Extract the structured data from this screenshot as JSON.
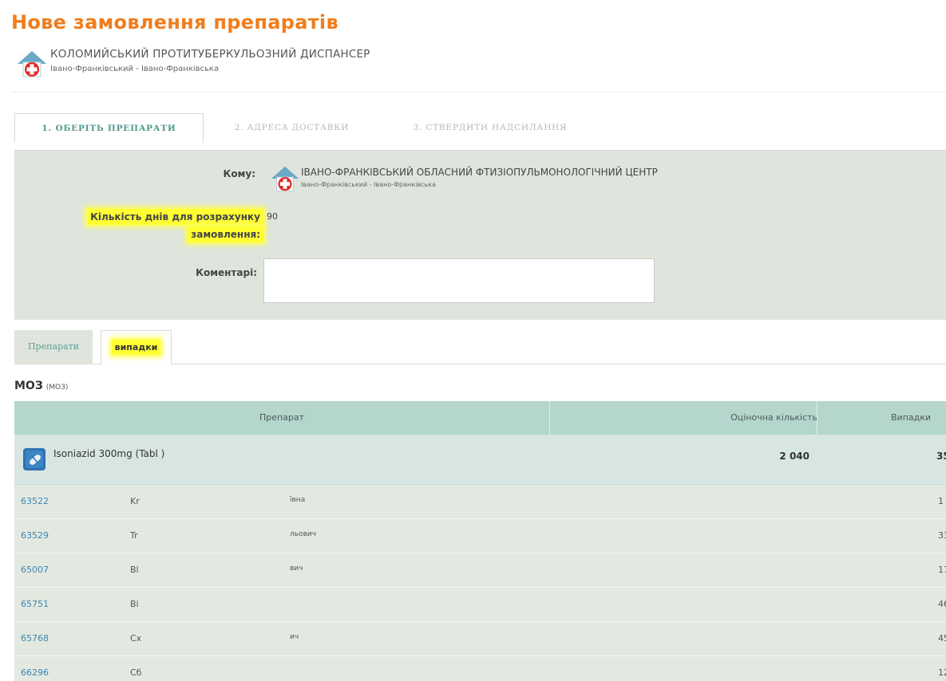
{
  "page": {
    "title": "Нове замовлення препаратів"
  },
  "org": {
    "name": "КОЛОМИЙСЬКИЙ ПРОТИТУБЕРКУЛЬОЗНИЙ ДИСПАНСЕР",
    "region": "Івано-Франківський - Івано-Франківська"
  },
  "wizard": {
    "steps": [
      {
        "label": "1. ОБЕРІТЬ ПРЕПАРАТИ",
        "active": true
      },
      {
        "label": "2. АДРЕСА ДОСТАВКИ",
        "active": false
      },
      {
        "label": "3. СТВЕРДИТИ НАДСИЛАННЯ",
        "active": false
      }
    ]
  },
  "form": {
    "komu_label": "Кому:",
    "recipient_name": "ІВАНО-ФРАНКІВСЬКИЙ ОБЛАСНИЙ ФТИЗІОПУЛЬМОНОЛОГІЧНИЙ ЦЕНТР",
    "recipient_region": "Івано-Франківський - Івано-Франківська",
    "days_label_line1": "Кількість днів для розрахунку",
    "days_label_line2": "замовлення:",
    "days_value": "90",
    "comment_label": "Коментарі:",
    "comment_value": ""
  },
  "tabs": [
    {
      "label": "Препарати",
      "active": false
    },
    {
      "label": "випадки",
      "active": true
    }
  ],
  "section": {
    "title": "МОЗ",
    "subtitle": "(МОЗ)"
  },
  "table": {
    "columns": [
      "Препарат",
      "Оціночна кількість",
      "Випадки"
    ],
    "drug": {
      "name": "Isoniazid 300mg (Tabl )",
      "quantity": "2 040",
      "cases": "35"
    },
    "rows": [
      {
        "id": "63522",
        "a": "Kr",
        "b": "ївна",
        "n": "1"
      },
      {
        "id": "63529",
        "a": "Tr",
        "b": "льович",
        "n": "33"
      },
      {
        "id": "65007",
        "a": "Bl",
        "b": "вич",
        "n": "17"
      },
      {
        "id": "65751",
        "a": "Bi",
        "b": "",
        "n": "46"
      },
      {
        "id": "65768",
        "a": "Cx",
        "b": "ич",
        "n": "45"
      },
      {
        "id": "66296",
        "a": "Сб",
        "b": "",
        "n": "12"
      }
    ]
  },
  "colors": {
    "title": "#f07d1c",
    "header_bg": "#b4d6cd",
    "panel_bg": "#dfe5dc",
    "highlight": "#ffff33",
    "link": "#3a86b5"
  },
  "icons": {
    "org_logo": "red-cross-icon",
    "drug_icon": "pill-icon"
  }
}
